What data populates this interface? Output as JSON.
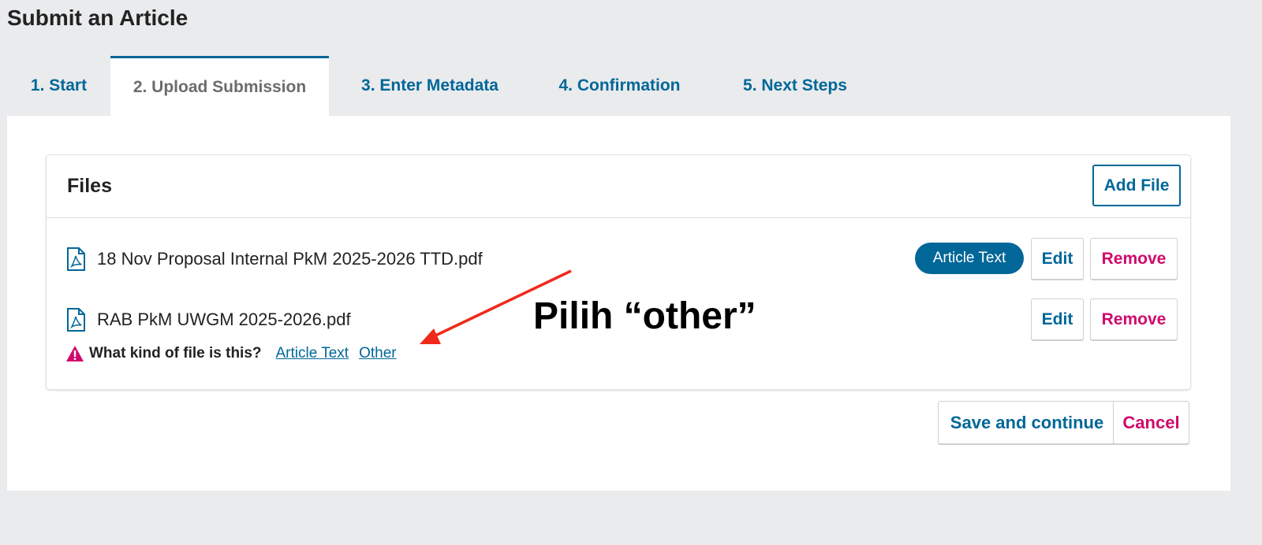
{
  "page": {
    "title": "Submit an Article"
  },
  "tabs": [
    {
      "label": "1. Start",
      "active": false
    },
    {
      "label": "2. Upload Submission",
      "active": true
    },
    {
      "label": "3. Enter Metadata",
      "active": false
    },
    {
      "label": "4. Confirmation",
      "active": false
    },
    {
      "label": "5. Next Steps",
      "active": false
    }
  ],
  "files": {
    "title": "Files",
    "add_file_label": "Add File",
    "items": [
      {
        "name": "18 Nov Proposal Internal PkM 2025-2026 TTD.pdf",
        "icon": "pdf-file-icon",
        "type_badge": "Article Text",
        "edit_label": "Edit",
        "remove_label": "Remove"
      },
      {
        "name": "RAB PkM UWGM 2025-2026.pdf",
        "icon": "pdf-file-icon",
        "type_badge": "",
        "edit_label": "Edit",
        "remove_label": "Remove"
      }
    ],
    "kind_prompt": {
      "icon": "warning-icon",
      "question": "What kind of file is this?",
      "options": [
        "Article Text",
        "Other"
      ]
    }
  },
  "annotation": {
    "text": "Pilih “other”",
    "arrow_color": "#f02a1a"
  },
  "actions": {
    "save_label": "Save and continue",
    "cancel_label": "Cancel"
  },
  "colors": {
    "primary": "#006798",
    "danger": "#d00a6c",
    "background": "#eaebed"
  }
}
